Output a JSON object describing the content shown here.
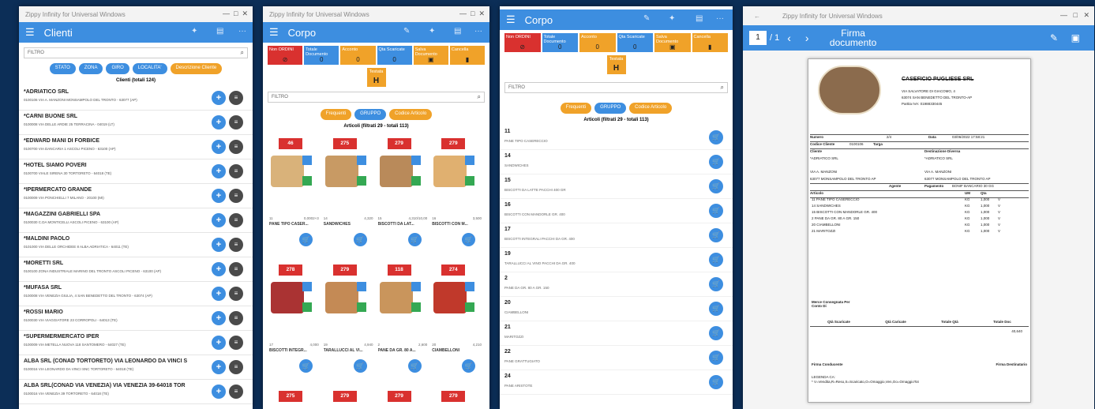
{
  "w1": {
    "title": "Zippy Infinity for Universal Windows",
    "appbar": "Clienti",
    "search_placeholder": "FILTRO",
    "chips": [
      "STATO",
      "ZONA",
      "GIRO",
      "LOCALITA'",
      "Descrizione Cliente"
    ],
    "count": "Clienti (totali 124)",
    "clients": [
      {
        "name": "*ADRIATICO SRL",
        "addr": "0100106 VIA A. MANZONI MONSAMPOLO DEL TRONTO - 63077 (AP)"
      },
      {
        "name": "*CARNI BUONE SRL",
        "addr": "0100008 VIA DELLE ARDIE 25 TERRACINA - 04019 (LT)"
      },
      {
        "name": "*EDWARD MANI DI FORBICE",
        "addr": "0100700 VIA DANCARIA 1 ASCOLI PICENO - 63100 (AP)"
      },
      {
        "name": "*HOTEL SIAMO POVERI",
        "addr": "0100700 VIALE SIRENA 30 TORTORETO - 64018 (TE)"
      },
      {
        "name": "*IPERMERCATO GRANDE",
        "addr": "0100009 VIA PONCHIELLI 7 MILANO - 20100 (MI)"
      },
      {
        "name": "*MAGAZZINI GABRIELLI SPA",
        "addr": "0100030 C.DA MONTICELLI ASCOLI PICENO - 63100 (AP)"
      },
      {
        "name": "*MALDINI PAOLO",
        "addr": "0101000 VIA DELLE ORCHIDEE 8 ALBA ADRIATICA - 64011 (TE)"
      },
      {
        "name": "*MORETTI SRL",
        "addr": "0100100 ZONA INDUSTRIALE MARINO DEL TRONTO ASCOLI PICENO - 63100 (AP)"
      },
      {
        "name": "*MUFASA SRL",
        "addr": "0100008 VIA VENEZIA GIULIA, 4 SAN BENEDETTO DEL TRONTO - 63074 (AP)"
      },
      {
        "name": "*ROSSI MARIO",
        "addr": "0100030 VIA VIAGGIATORE 23 CORROPOLI - 64013 (TE)"
      },
      {
        "name": "*SUPERMERMERCATO IPER",
        "addr": "0100009 VIA METELLA NUOVA 118 SANTOMERO - 64027 (TE)"
      },
      {
        "name": "ALBA SRL (CONAD TORTORETO) VIA LEONARDO DA VINCI S",
        "addr": "0100016 VIA LEONARDO DA VINCI SNC TORTORETO - 64018 (TE)"
      },
      {
        "name": "ALBA SRL(CONAD VIA VENEZIA) VIA VENEZIA 39-64018 TOR",
        "addr": "0100016 VIA VENEZIA 39 TORTORETO - 64018 (TE)"
      }
    ]
  },
  "w2": {
    "title": "Zippy Infinity for Universal Windows",
    "appbar": "Corpo",
    "tools": [
      {
        "label": "Non ORDINI",
        "sym": "⊘",
        "color": "red"
      },
      {
        "label": "Totale Documento",
        "sym": "0",
        "color": "blue"
      },
      {
        "label": "Acconto",
        "sym": "0",
        "color": "orange"
      },
      {
        "label": "Qta Scaricate",
        "sym": "0",
        "color": "blue"
      },
      {
        "label": "Salva Documento",
        "sym": "▣",
        "color": "orange"
      },
      {
        "label": "Cancella",
        "sym": "▮",
        "color": "orange"
      }
    ],
    "testata": "Testata",
    "testata_sym": "H",
    "search_placeholder": "FILTRO",
    "chips": [
      "Frequenti",
      "GRUPPO",
      "Codice Articolo"
    ],
    "count": "Articoli (filtrati 29 - totali 113)",
    "products": [
      {
        "price": "46",
        "c1": "11",
        "c2": "0,0002+3",
        "name": "PANE TIPO CASER..."
      },
      {
        "price": "275",
        "c1": "14",
        "c2": "4,320",
        "name": "SANDWICHES"
      },
      {
        "price": "279",
        "c1": "15",
        "c2": "4,310/10,00",
        "name": "BISCOTTI DA LAT..."
      },
      {
        "price": "279",
        "c1": "16",
        "c2": "3,500",
        "name": "BISCOTTI CON M..."
      },
      {
        "price": "278",
        "c1": "17",
        "c2": "4,000",
        "name": "BISCOTTI INTEGR..."
      },
      {
        "price": "279",
        "c1": "19",
        "c2": "4,940",
        "name": "TARALLUCCI AL VI..."
      },
      {
        "price": "118",
        "c1": "2",
        "c2": "2,600",
        "name": "PANE DA GR. 80 A..."
      },
      {
        "price": "274",
        "c1": "20",
        "c2": "4,210",
        "name": "CIAMBELLONI"
      }
    ],
    "prices_row3": [
      "275",
      "279",
      "279",
      "279"
    ]
  },
  "w3": {
    "appbar": "Corpo",
    "tools": [
      {
        "label": "Non ORDINI",
        "sym": "⊘",
        "color": "red"
      },
      {
        "label": "Totale Documento",
        "sym": "0",
        "color": "blue"
      },
      {
        "label": "Acconto",
        "sym": "0",
        "color": "orange"
      },
      {
        "label": "Qta Scaricate",
        "sym": "0",
        "color": "blue"
      },
      {
        "label": "Salva Documento",
        "sym": "▣",
        "color": "orange"
      },
      {
        "label": "Cancella",
        "sym": "▮",
        "color": "orange"
      }
    ],
    "testata": "Testata",
    "testata_sym": "H",
    "search_placeholder": "FILTRO",
    "chips": [
      "Frequenti",
      "GRUPPO",
      "Codice Articolo"
    ],
    "count": "Articoli (filtrati 29 - totali 113)",
    "items": [
      {
        "code": "11",
        "desc": "PANE TIPO CASERECCIO"
      },
      {
        "code": "14",
        "desc": "SANDWICHES"
      },
      {
        "code": "15",
        "desc": "BISCOTTI DA LATTE PACCHI 400 GR"
      },
      {
        "code": "16",
        "desc": "BISCOTTI CON MANDORLE GR. 400"
      },
      {
        "code": "17",
        "desc": "BISCOTTI INTEGRALI PACCHI DA GR. 400"
      },
      {
        "code": "19",
        "desc": "TARALLUCCI AL VINO PACCHI DA GR. 400"
      },
      {
        "code": "2",
        "desc": "PANE DA GR. 80 A GR. 150"
      },
      {
        "code": "20",
        "desc": "CIAMBELLONI"
      },
      {
        "code": "21",
        "desc": "MARITOZZI"
      },
      {
        "code": "22",
        "desc": "PANE GRATTUGIATO"
      },
      {
        "code": "24",
        "desc": "PANE ARISTOTE"
      }
    ]
  },
  "w4": {
    "title": "Zippy Infinity for Universal Windows",
    "page_current": "1",
    "page_total": "/ 1",
    "firma": "Firma documento",
    "doc": {
      "company": "CASEFICIO PUGLIESE SRL",
      "addr1": "VIA SALVATORE DI GIACOMO, 4",
      "addr2": "63074 SAN BENEDETTO DEL TRONTO-AP",
      "piva": "Partita IVA: 01988330445",
      "numero_label": "Numero",
      "numero_val": "2/4",
      "data_label": "Data",
      "data_val": "03/06/2022 17:58:21",
      "codcli_label": "Codice Cliente",
      "codcli_val": "0100106",
      "targa_label": "Targa",
      "cliente_label": "Cliente",
      "cliente_val": "*ADRIATICO SRL",
      "dest_label": "Destinazione Diversa",
      "dest_val": "*ADRIATICO SRL",
      "via": "VIA A. MANZONI",
      "citta": "63077 MONSAMPOLO DEL TRONTO AP",
      "agente_label": "Agente",
      "pagamento_label": "Pagamento",
      "pagamento_val": "BONIF BANCARIO 30 GG",
      "articolo_label": "Articolo",
      "um_label": "UM",
      "qta_label": "Qta",
      "rows": [
        "11 PANE TIPO CASERECCIO",
        "14 SANDWICHES",
        "15 BISCOTTI CON MANDORLE GR. 400",
        "2 PANE DA GR. 80 A GR. 150",
        "20 CIAMBELLONI",
        "21 MARITOZZI"
      ],
      "um": "KG",
      "qty": "1,000",
      "v": "V",
      "merce": "Merce Consegnata Per Conto Di",
      "qs_label": "Qtà Scaricate",
      "qc_label": "Qtà Caricate",
      "tq_label": "Totale Qtà",
      "td_label": "Totale Doc",
      "td_val": "40,640",
      "firma_cond": "Firma Conducente",
      "firma_dest": "Firma Destinatario",
      "legenda": "LEGENDA CA:",
      "legenda2": "* V=Vendita,R=Reso,S=Scaricato,O=Omaggio,Ven,Oo=OmaggioTot"
    }
  }
}
